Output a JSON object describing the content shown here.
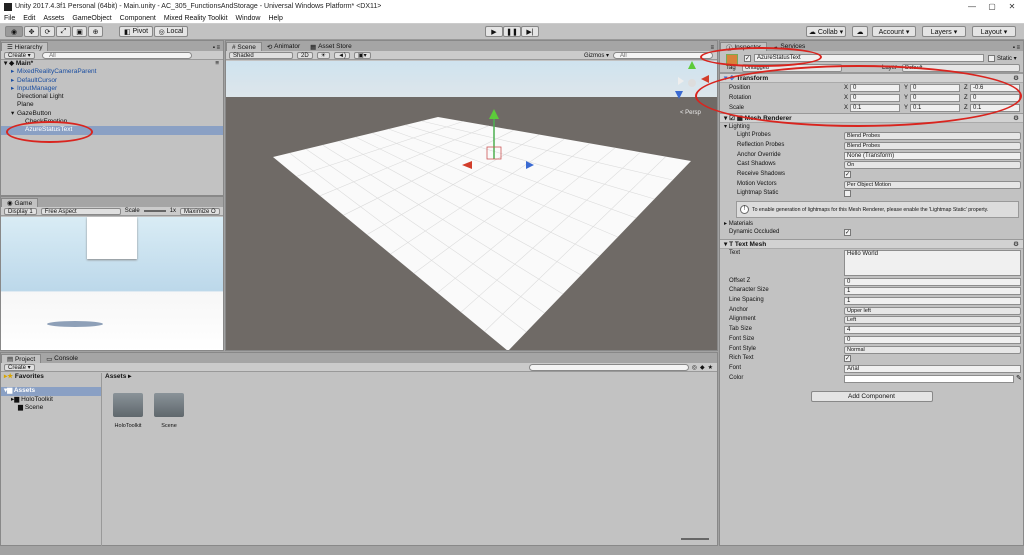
{
  "window": {
    "title": "Unity 2017.4.3f1 Personal (64bit) - Main.unity - AC_305_FunctionsAndStorage - Universal Windows Platform* <DX11>",
    "controls": [
      "—",
      "▢",
      "✕"
    ]
  },
  "menu": [
    "File",
    "Edit",
    "Assets",
    "GameObject",
    "Component",
    "Mixed Reality Toolkit",
    "Window",
    "Help"
  ],
  "toolbar": {
    "pivot": "Pivot",
    "local": "Local",
    "collab": "Collab ▾",
    "account": "Account ▾",
    "layers": "Layers ▾",
    "layout": "Layout ▾",
    "tools": [
      "hand",
      "move",
      "rotate",
      "scale",
      "rect",
      "transform"
    ],
    "play": [
      "play",
      "pause",
      "step"
    ]
  },
  "hierarchy": {
    "tab": "Hierarchy",
    "create": "Create ▾",
    "search": "All",
    "scene": "Main*",
    "items": [
      {
        "label": "MixedRealityCameraParent",
        "indent": 1,
        "arrow": "▸",
        "blue": true
      },
      {
        "label": "DefaultCursor",
        "indent": 1,
        "arrow": "▸",
        "blue": true
      },
      {
        "label": "InputManager",
        "indent": 1,
        "arrow": "▸",
        "blue": true
      },
      {
        "label": "Directional Light",
        "indent": 1,
        "arrow": "",
        "blue": false
      },
      {
        "label": "Plane",
        "indent": 1,
        "arrow": "",
        "blue": false
      },
      {
        "label": "GazeButton",
        "indent": 1,
        "arrow": "▾",
        "blue": false
      },
      {
        "label": "CheckEmotion",
        "indent": 2,
        "arrow": "",
        "blue": false
      },
      {
        "label": "AzureStatusText",
        "indent": 2,
        "arrow": "",
        "blue": false,
        "selected": true
      }
    ]
  },
  "game": {
    "tab": "Game",
    "display": "Display 1",
    "aspect": "Free Aspect",
    "scale_label": "Scale",
    "scale_value": "1x",
    "maximize": "Maximize O"
  },
  "scene": {
    "tabs": [
      "Scene",
      "Animator",
      "Asset Store"
    ],
    "shading": "Shaded",
    "mode2d": "2D",
    "gizmos": "Gizmos ▾",
    "search": "All",
    "persp": "< Persp"
  },
  "project": {
    "tabs": [
      "Project",
      "Console"
    ],
    "create": "Create ▾",
    "favorites": "Favorites",
    "assets_root": "Assets",
    "tree": [
      "HoloToolkit",
      "Scene"
    ],
    "breadcrumb": "Assets ▸",
    "folders": [
      "HoloToolkit",
      "Scene"
    ]
  },
  "inspector": {
    "tabs": [
      "Inspector",
      "Services"
    ],
    "object_name": "AzureStatusText",
    "static": "Static ▾",
    "tag_label": "Tag",
    "tag_value": "Untagged",
    "layer_label": "Layer",
    "layer_value": "Default",
    "transform": {
      "title": "Transform",
      "rows": [
        {
          "label": "Position",
          "x": "0",
          "y": "0",
          "z": "-0.6"
        },
        {
          "label": "Rotation",
          "x": "0",
          "y": "0",
          "z": "0"
        },
        {
          "label": "Scale",
          "x": "0.1",
          "y": "0.1",
          "z": "0.1"
        }
      ]
    },
    "mesh_renderer": {
      "title": "Mesh Renderer",
      "lighting": "Lighting",
      "rows": [
        {
          "label": "Light Probes",
          "value": "Blend Probes",
          "kind": "drop"
        },
        {
          "label": "Reflection Probes",
          "value": "Blend Probes",
          "kind": "drop"
        },
        {
          "label": "Anchor Override",
          "value": "None (Transform)",
          "kind": "field"
        },
        {
          "label": "Cast Shadows",
          "value": "On",
          "kind": "drop"
        },
        {
          "label": "Receive Shadows",
          "value": "✓",
          "kind": "chk"
        },
        {
          "label": "Motion Vectors",
          "value": "Per Object Motion",
          "kind": "drop"
        },
        {
          "label": "Lightmap Static",
          "value": "",
          "kind": "chk"
        }
      ],
      "info": "To enable generation of lightmaps for this Mesh Renderer, please enable the 'Lightmap Static' property.",
      "materials": "Materials",
      "dynamic_occluded": "Dynamic Occluded",
      "dynamic_occluded_value": "✓"
    },
    "text_mesh": {
      "title": "Text Mesh",
      "text_label": "Text",
      "text_value": "Hello World",
      "rows": [
        {
          "label": "Offset Z",
          "value": "0",
          "kind": "field"
        },
        {
          "label": "Character Size",
          "value": "1",
          "kind": "field"
        },
        {
          "label": "Line Spacing",
          "value": "1",
          "kind": "field"
        },
        {
          "label": "Anchor",
          "value": "Upper left",
          "kind": "drop"
        },
        {
          "label": "Alignment",
          "value": "Left",
          "kind": "drop"
        },
        {
          "label": "Tab Size",
          "value": "4",
          "kind": "field"
        },
        {
          "label": "Font Size",
          "value": "0",
          "kind": "field"
        },
        {
          "label": "Font Style",
          "value": "Normal",
          "kind": "drop"
        },
        {
          "label": "Rich Text",
          "value": "✓",
          "kind": "chk"
        },
        {
          "label": "Font",
          "value": "Arial",
          "kind": "field"
        },
        {
          "label": "Color",
          "value": "",
          "kind": "color"
        }
      ]
    },
    "add_component": "Add Component"
  },
  "colors": {
    "sky": "#cfe3ef",
    "ground": "#6f6a66",
    "grid": "#ffffff",
    "annotation": "#d9241e",
    "selection": "#8aa0c4"
  }
}
